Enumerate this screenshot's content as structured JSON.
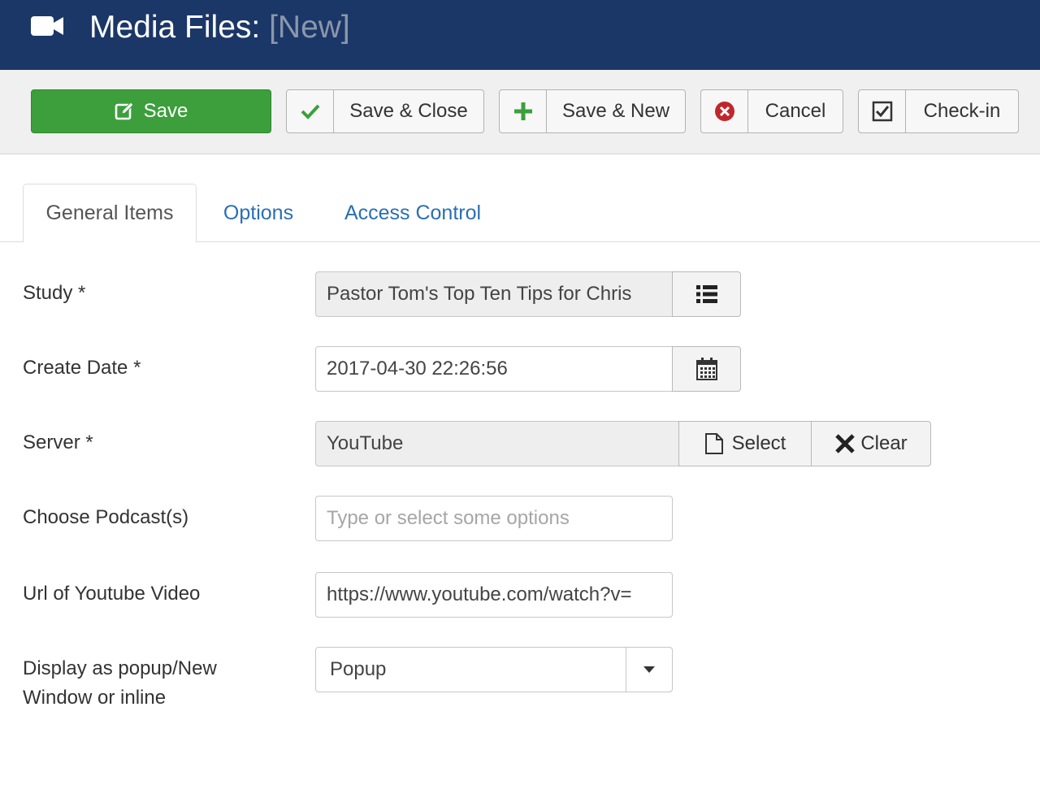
{
  "header": {
    "title": "Media Files:",
    "title_suffix": "[New]",
    "icon": "video-camera-icon"
  },
  "toolbar": {
    "save": "Save",
    "save_close": "Save & Close",
    "save_new": "Save & New",
    "cancel": "Cancel",
    "checkin": "Check-in"
  },
  "tabs": {
    "general": "General Items",
    "options": "Options",
    "access": "Access Control",
    "active": "General Items"
  },
  "form": {
    "study": {
      "label": "Study *",
      "value": "Pastor Tom's Top Ten Tips for Chris"
    },
    "create_date": {
      "label": "Create Date *",
      "value": "2017-04-30 22:26:56"
    },
    "server": {
      "label": "Server *",
      "value": "YouTube",
      "select": "Select",
      "clear": "Clear"
    },
    "podcast": {
      "label": "Choose Podcast(s)",
      "placeholder": "Type or select some options"
    },
    "url": {
      "label": "Url of Youtube Video",
      "value": "https://www.youtube.com/watch?v="
    },
    "display": {
      "label_line1": "Display as popup/New",
      "label_line2": "Window or inline",
      "value": "Popup"
    }
  },
  "colors": {
    "header_bg": "#1b3767",
    "save_green": "#3c9f3c",
    "link_blue": "#2a6fb3",
    "cancel_red": "#c0272d"
  }
}
